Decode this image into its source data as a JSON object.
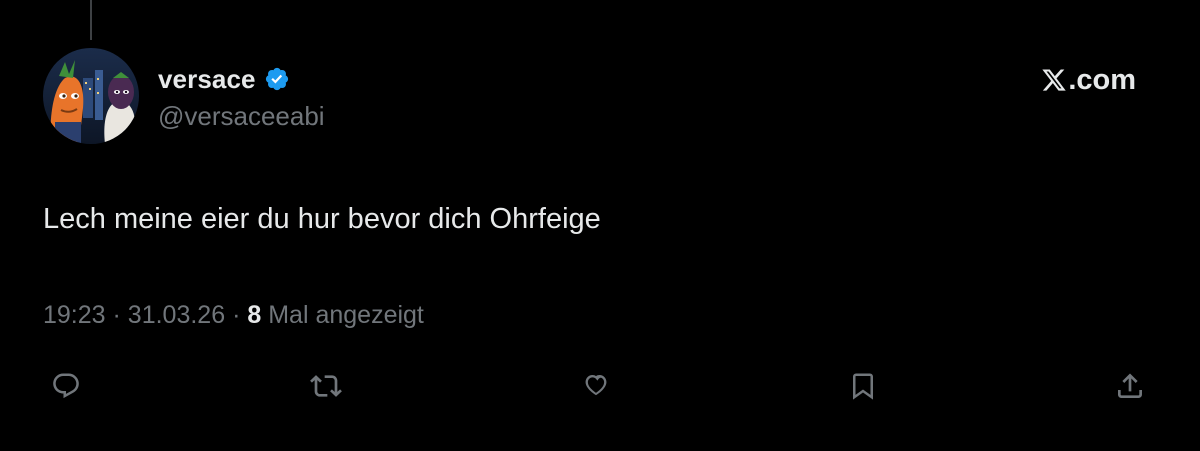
{
  "tweet": {
    "display_name": "versace",
    "verified": true,
    "handle": "@versaceeabi",
    "text": "Lech meine eier du hur bevor dich Ohrfeige",
    "time": "19:23",
    "date": "31.03.26",
    "separator": "·",
    "views_count": "8",
    "views_label": "Mal angezeigt"
  },
  "brand": {
    "logo_icon": "x-logo-icon",
    "domain": ".com"
  },
  "actions": [
    {
      "icon": "reply-icon"
    },
    {
      "icon": "retweet-icon"
    },
    {
      "icon": "like-icon"
    },
    {
      "icon": "bookmark-icon"
    },
    {
      "icon": "share-icon"
    }
  ],
  "colors": {
    "background": "#000000",
    "primary_text": "#e7e9ea",
    "secondary_text": "#71767b",
    "verified_blue": "#1d9bf0",
    "thread_line": "#3e4144"
  }
}
